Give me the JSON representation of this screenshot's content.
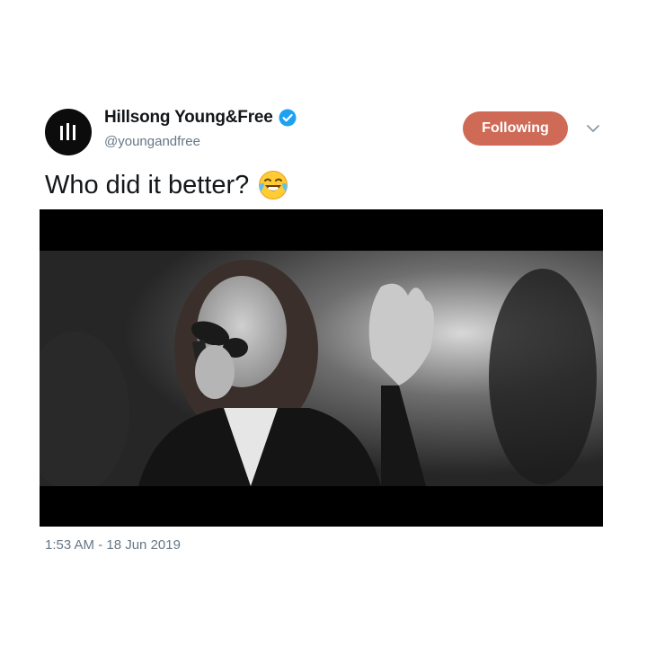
{
  "tweet": {
    "author": {
      "name": "Hillsong Young&Free",
      "handle": "@youngandfree",
      "avatar_icon": "hillsong-logo-icon",
      "verified_icon": "verified-badge-icon"
    },
    "follow_button_label": "Following",
    "menu_icon": "chevron-down-icon",
    "text": "Who did it better?",
    "emoji_icon": "face-with-tears-of-joy-icon",
    "media": {
      "type": "video",
      "description_icon": "video-still"
    },
    "timestamp": "1:53 AM - 18 Jun 2019"
  },
  "colors": {
    "following_button": "#cf6a57",
    "verified_badge": "#1da1f2",
    "secondary_text": "#657786",
    "primary_text": "#14171a"
  }
}
